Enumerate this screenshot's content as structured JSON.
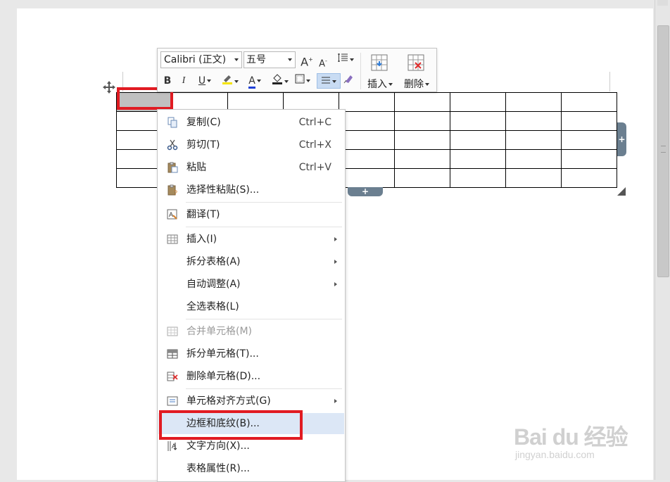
{
  "toolbar": {
    "font_name": "Calibri (正文)",
    "font_size": "五号",
    "bold": "B",
    "italic": "I",
    "underline": "U",
    "font_color_letter": "A",
    "insert_label": "插入",
    "delete_label": "删除"
  },
  "context_menu": {
    "items": [
      {
        "label": "复制(C)",
        "shortcut": "Ctrl+C",
        "icon": "copy-icon"
      },
      {
        "label": "剪切(T)",
        "shortcut": "Ctrl+X",
        "icon": "scissors-icon"
      },
      {
        "label": "粘贴",
        "shortcut": "Ctrl+V",
        "icon": "paste-icon"
      },
      {
        "label": "选择性粘贴(S)...",
        "icon": "paste-special-icon"
      },
      {
        "label": "翻译(T)",
        "icon": "translate-icon"
      },
      {
        "label": "插入(I)",
        "icon": "table-insert-icon",
        "submenu": true
      },
      {
        "label": "拆分表格(A)",
        "submenu": true
      },
      {
        "label": "自动调整(A)",
        "submenu": true
      },
      {
        "label": "全选表格(L)"
      },
      {
        "label": "合并单元格(M)",
        "icon": "merge-cells-icon",
        "disabled": true
      },
      {
        "label": "拆分单元格(T)...",
        "icon": "split-cells-icon"
      },
      {
        "label": "删除单元格(D)...",
        "icon": "delete-cells-icon"
      },
      {
        "label": "单元格对齐方式(G)",
        "icon": "cell-align-icon",
        "submenu": true
      },
      {
        "label": "边框和底纹(B)...",
        "highlighted": true
      },
      {
        "label": "文字方向(X)...",
        "icon": "text-direction-icon"
      },
      {
        "label": "表格属性(R)..."
      }
    ]
  },
  "table": {
    "rows": 5,
    "cols": 9
  },
  "watermark": {
    "brand": "Bai du 经验",
    "url": "jingyan.baidu.com"
  },
  "colors": {
    "highlight": "#dce7f6",
    "red_box": "#e11b22",
    "selected_cell": "#c0c0c0"
  }
}
